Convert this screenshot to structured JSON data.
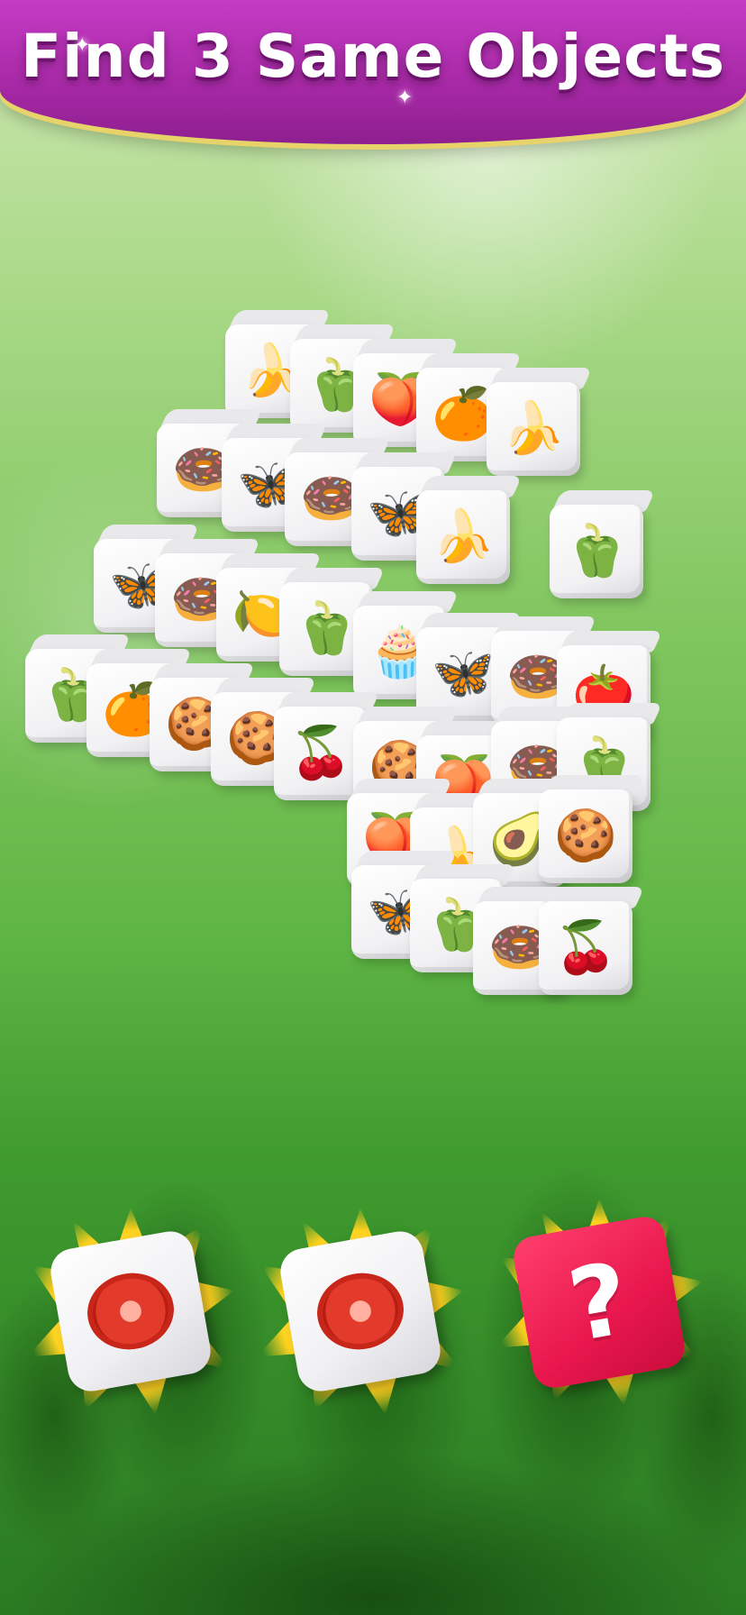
{
  "banner": {
    "title": "Find 3 Same Objects"
  },
  "board": {
    "tiles": [
      {
        "icon": "banana",
        "glyph": "🍌"
      },
      {
        "icon": "red-pepper",
        "glyph": "🫑"
      },
      {
        "icon": "peach",
        "glyph": "🍑"
      },
      {
        "icon": "orange",
        "glyph": "🍊"
      },
      {
        "icon": "banana",
        "glyph": "🍌"
      },
      {
        "icon": "bundt-cake",
        "glyph": "🍩"
      },
      {
        "icon": "butterfly",
        "glyph": "🦋"
      },
      {
        "icon": "bundt-cake",
        "glyph": "🍩"
      },
      {
        "icon": "butterfly",
        "glyph": "🦋"
      },
      {
        "icon": "banana",
        "glyph": "🍌"
      },
      {
        "icon": "yellow-pepper",
        "glyph": "🫑"
      },
      {
        "icon": "butterfly",
        "glyph": "🦋"
      },
      {
        "icon": "bundt-cake",
        "glyph": "🍩"
      },
      {
        "icon": "lemon",
        "glyph": "🍋"
      },
      {
        "icon": "yellow-pepper",
        "glyph": "🫑"
      },
      {
        "icon": "muffin",
        "glyph": "🧁"
      },
      {
        "icon": "butterfly",
        "glyph": "🦋"
      },
      {
        "icon": "bundt-cake",
        "glyph": "🍩"
      },
      {
        "icon": "tomato",
        "glyph": "🍅"
      },
      {
        "icon": "yellow-pepper",
        "glyph": "🫑"
      },
      {
        "icon": "orange",
        "glyph": "🍊"
      },
      {
        "icon": "cookie",
        "glyph": "🍪"
      },
      {
        "icon": "cookie",
        "glyph": "🍪"
      },
      {
        "icon": "plum",
        "glyph": "🍒"
      },
      {
        "icon": "cookie",
        "glyph": "🍪"
      },
      {
        "icon": "peach",
        "glyph": "🍑"
      },
      {
        "icon": "bundt-cake",
        "glyph": "🍩"
      },
      {
        "icon": "yellow-pepper",
        "glyph": "🫑"
      },
      {
        "icon": "peach",
        "glyph": "🍑"
      },
      {
        "icon": "banana",
        "glyph": "🍌"
      },
      {
        "icon": "avocado",
        "glyph": "🥑"
      },
      {
        "icon": "cookie",
        "glyph": "🍪"
      },
      {
        "icon": "butterfly",
        "glyph": "🦋"
      },
      {
        "icon": "yellow-pepper",
        "glyph": "🫑"
      },
      {
        "icon": "bundt-cake",
        "glyph": "🍩"
      },
      {
        "icon": "plum",
        "glyph": "🍒"
      }
    ]
  },
  "collection_slots": [
    {
      "icon": "tomato-die-icon",
      "state": "filled"
    },
    {
      "icon": "tomato-die-icon",
      "state": "filled"
    },
    {
      "icon": "question-mark-icon",
      "state": "empty",
      "glyph": "?"
    }
  ]
}
